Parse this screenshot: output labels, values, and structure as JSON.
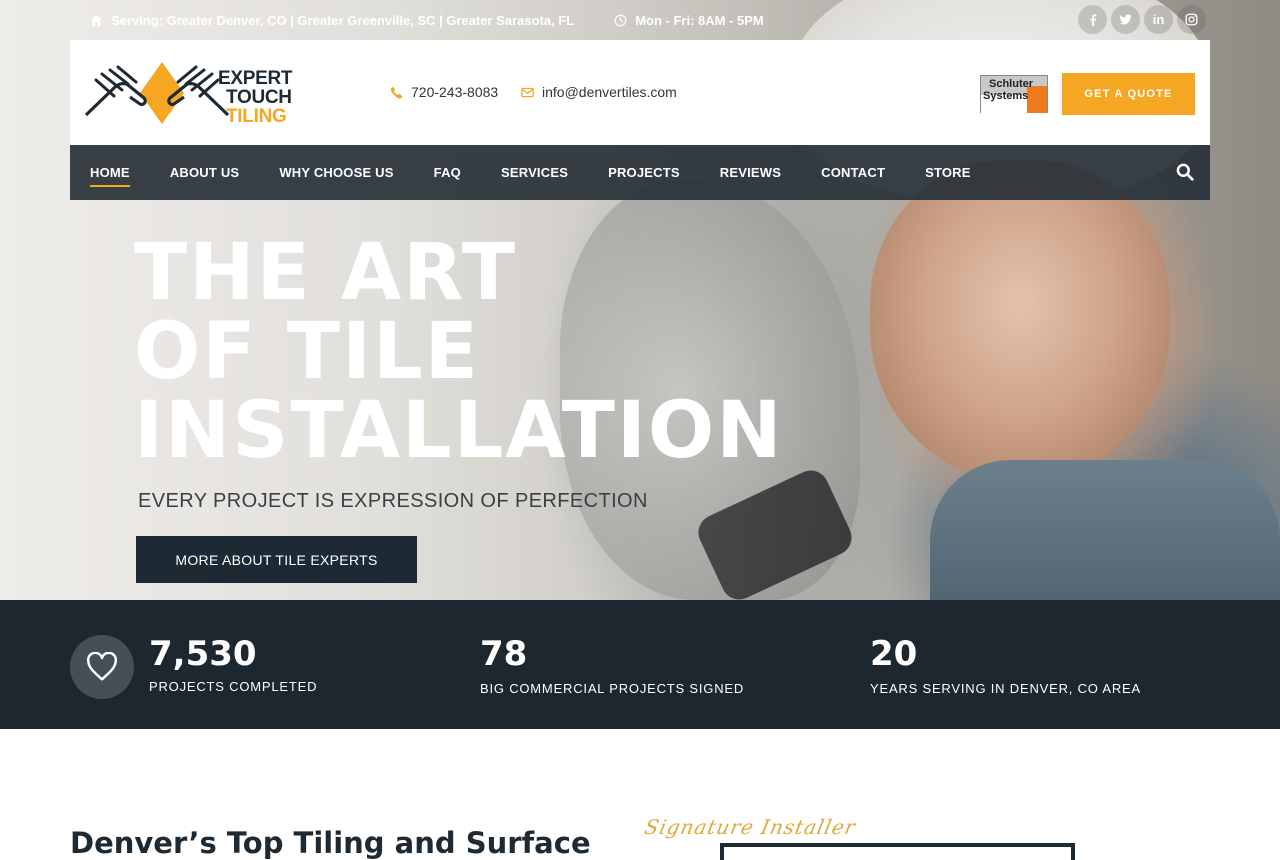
{
  "topbar": {
    "serving": "Serving: Greater Denver, CO | Greater Greenville, SC | Greater Sarasota, FL",
    "hours": "Mon - Fri: 8AM - 5PM"
  },
  "socials": [
    "f",
    "t",
    "in",
    "ig"
  ],
  "header": {
    "logo_line1": "EXPERT",
    "logo_line2": "TOUCH",
    "logo_line3": "TILING",
    "phone": "720-243-8083",
    "email": "info@denvertiles.com",
    "partner_line1": "Schluter",
    "partner_line2": "Systems",
    "quote_label": "GET A QUOTE"
  },
  "nav": {
    "items": [
      "HOME",
      "ABOUT US",
      "WHY CHOOSE US",
      "FAQ",
      "SERVICES",
      "PROJECTS",
      "REVIEWS",
      "CONTACT",
      "STORE"
    ],
    "active": "HOME"
  },
  "hero": {
    "title_line1": "THE ART",
    "title_line2": "OF TILE",
    "title_line3": "INSTALLATION",
    "subtitle": "EVERY PROJECT IS EXPRESSION OF PERFECTION",
    "button": "MORE ABOUT TILE EXPERTS"
  },
  "stats": [
    {
      "value": "7,530",
      "label": "PROJECTS COMPLETED"
    },
    {
      "value": "78",
      "label": "BIG COMMERCIAL PROJECTS SIGNED"
    },
    {
      "value": "20",
      "label": "YEARS SERVING IN DENVER, CO AREA"
    }
  ],
  "intro": {
    "heading": "Denver’s Top Tiling and Surface",
    "signature": "Signature Installer"
  },
  "colors": {
    "accent": "#f5a623",
    "dark": "#1e2a33",
    "nav_bg": "#283138"
  }
}
